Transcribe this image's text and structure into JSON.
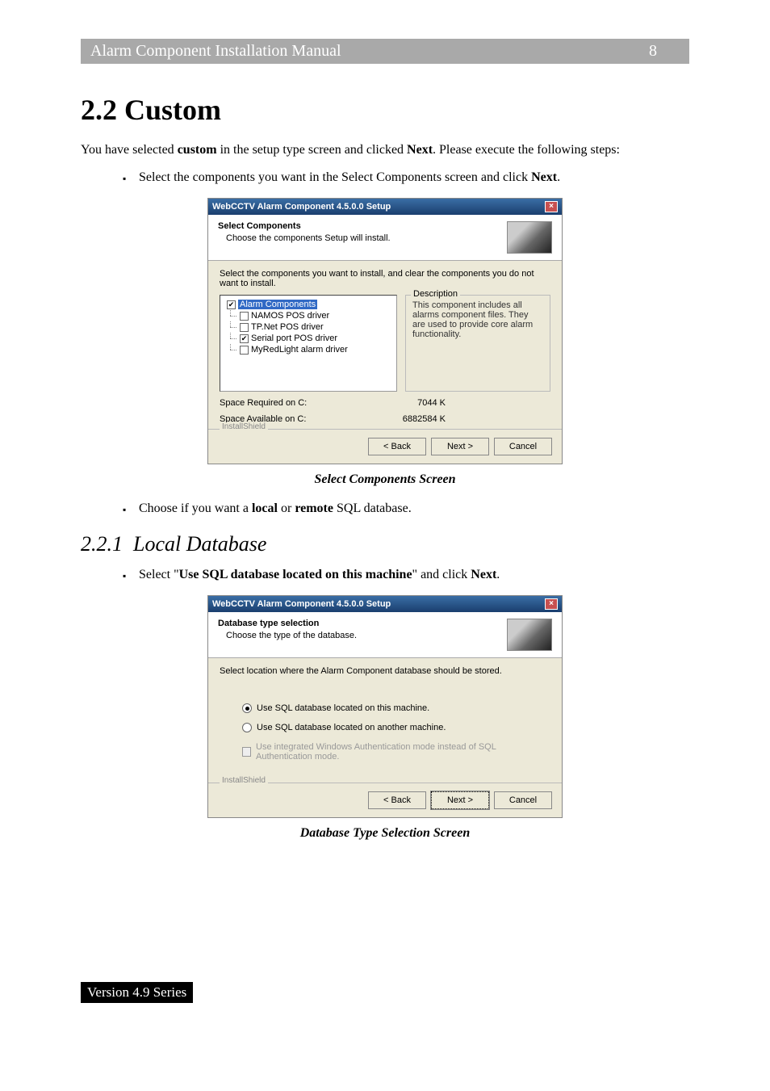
{
  "header": {
    "title": "Alarm Component Installation Manual",
    "page": "8"
  },
  "section": {
    "number": "2.2",
    "title": "Custom"
  },
  "intro": {
    "prefix": "You have selected ",
    "bold1": "custom",
    "mid": " in the setup type screen and clicked ",
    "bold2": "Next",
    "suffix": ". Please execute the following steps:"
  },
  "bullet1": {
    "prefix": "Select the components you want in the Select Components screen and click ",
    "bold": "Next",
    "suffix": "."
  },
  "dialog1": {
    "title": "WebCCTV Alarm Component 4.5.0.0 Setup",
    "heading": "Select Components",
    "subheading": "Choose the components Setup will install.",
    "instruction": "Select the components you want to install, and clear the components you do not want to install.",
    "tree": [
      {
        "label": "Alarm Components",
        "checked": true,
        "selected": true
      },
      {
        "label": "NAMOS POS driver",
        "checked": false,
        "selected": false
      },
      {
        "label": "TP.Net POS driver",
        "checked": false,
        "selected": false
      },
      {
        "label": "Serial port POS driver",
        "checked": true,
        "selected": false
      },
      {
        "label": "MyRedLight alarm driver",
        "checked": false,
        "selected": false
      }
    ],
    "descbox_legend": "Description",
    "description": "This component includes all alarms component files. They are used to provide core alarm functionality.",
    "space_req_label": "Space Required on  C:",
    "space_req_val": "7044 K",
    "space_av_label": "Space Available on  C:",
    "space_av_val": "6882584 K",
    "brand": "InstallShield",
    "buttons": {
      "back": "< Back",
      "next": "Next >",
      "cancel": "Cancel"
    }
  },
  "caption1": "Select Components Screen",
  "bullet2": {
    "prefix": "Choose if you want a ",
    "bold1": "local",
    "mid": " or ",
    "bold2": "remote",
    "suffix": " SQL database."
  },
  "subsection": {
    "number": "2.2.1",
    "title": "Local Database"
  },
  "bullet3": {
    "prefix": "Select \"",
    "bold1": "Use SQL database located on this machine",
    "mid": "\" and click ",
    "bold2": "Next",
    "suffix": "."
  },
  "dialog2": {
    "title": "WebCCTV Alarm Component 4.5.0.0 Setup",
    "heading": "Database type selection",
    "subheading": "Choose the type of the database.",
    "instruction": "Select location where the Alarm Component database should be stored.",
    "radio1": "Use SQL database located on this machine.",
    "radio2": "Use SQL database located on another machine.",
    "check1": "Use integrated Windows Authentication mode instead of SQL Authentication mode.",
    "brand": "InstallShield",
    "buttons": {
      "back": "< Back",
      "next": "Next >",
      "cancel": "Cancel"
    }
  },
  "caption2": "Database Type Selection Screen",
  "footer": "Version 4.9 Series"
}
